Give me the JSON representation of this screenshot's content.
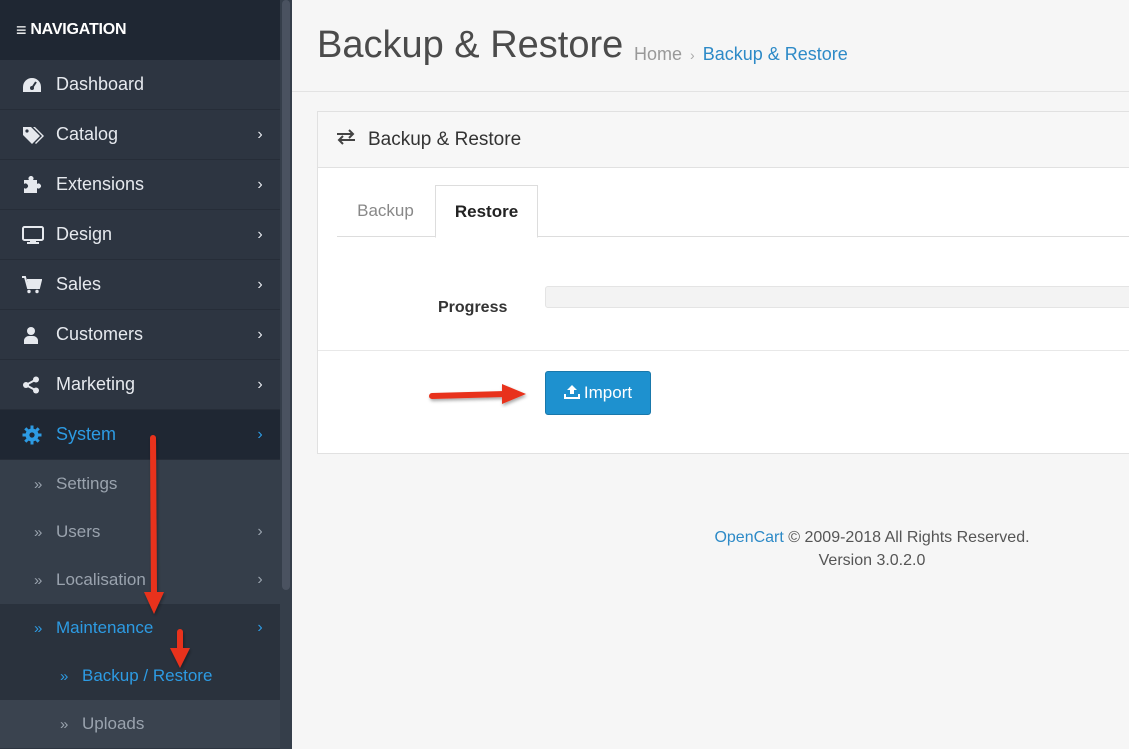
{
  "sidebar": {
    "header": "NAVIGATION",
    "items": [
      {
        "label": "Dashboard",
        "icon": "dashboard-icon"
      },
      {
        "label": "Catalog",
        "icon": "tags-icon"
      },
      {
        "label": "Extensions",
        "icon": "puzzle-icon"
      },
      {
        "label": "Design",
        "icon": "desktop-icon"
      },
      {
        "label": "Sales",
        "icon": "cart-icon"
      },
      {
        "label": "Customers",
        "icon": "user-icon"
      },
      {
        "label": "Marketing",
        "icon": "share-icon"
      },
      {
        "label": "System",
        "icon": "gear-icon"
      }
    ],
    "system_sub": [
      {
        "label": "Settings"
      },
      {
        "label": "Users"
      },
      {
        "label": "Localisation"
      },
      {
        "label": "Maintenance"
      }
    ],
    "maintenance_sub": [
      {
        "label": "Backup / Restore"
      },
      {
        "label": "Uploads"
      }
    ]
  },
  "header": {
    "title": "Backup & Restore",
    "breadcrumb": [
      "Home",
      "Backup & Restore"
    ]
  },
  "panel": {
    "title": "Backup & Restore",
    "tabs": [
      "Backup",
      "Restore"
    ],
    "active_tab": "Restore",
    "progress_label": "Progress",
    "progress_value": 0,
    "import_label": "Import"
  },
  "footer": {
    "brand": "OpenCart",
    "copyright": " © 2009-2018 All Rights Reserved.",
    "version": "Version 3.0.2.0"
  },
  "colors": {
    "accent": "#2d9be3",
    "sidebar_bg": "#2d3541",
    "button": "#1e91cf",
    "annotation": "#e8331c"
  }
}
